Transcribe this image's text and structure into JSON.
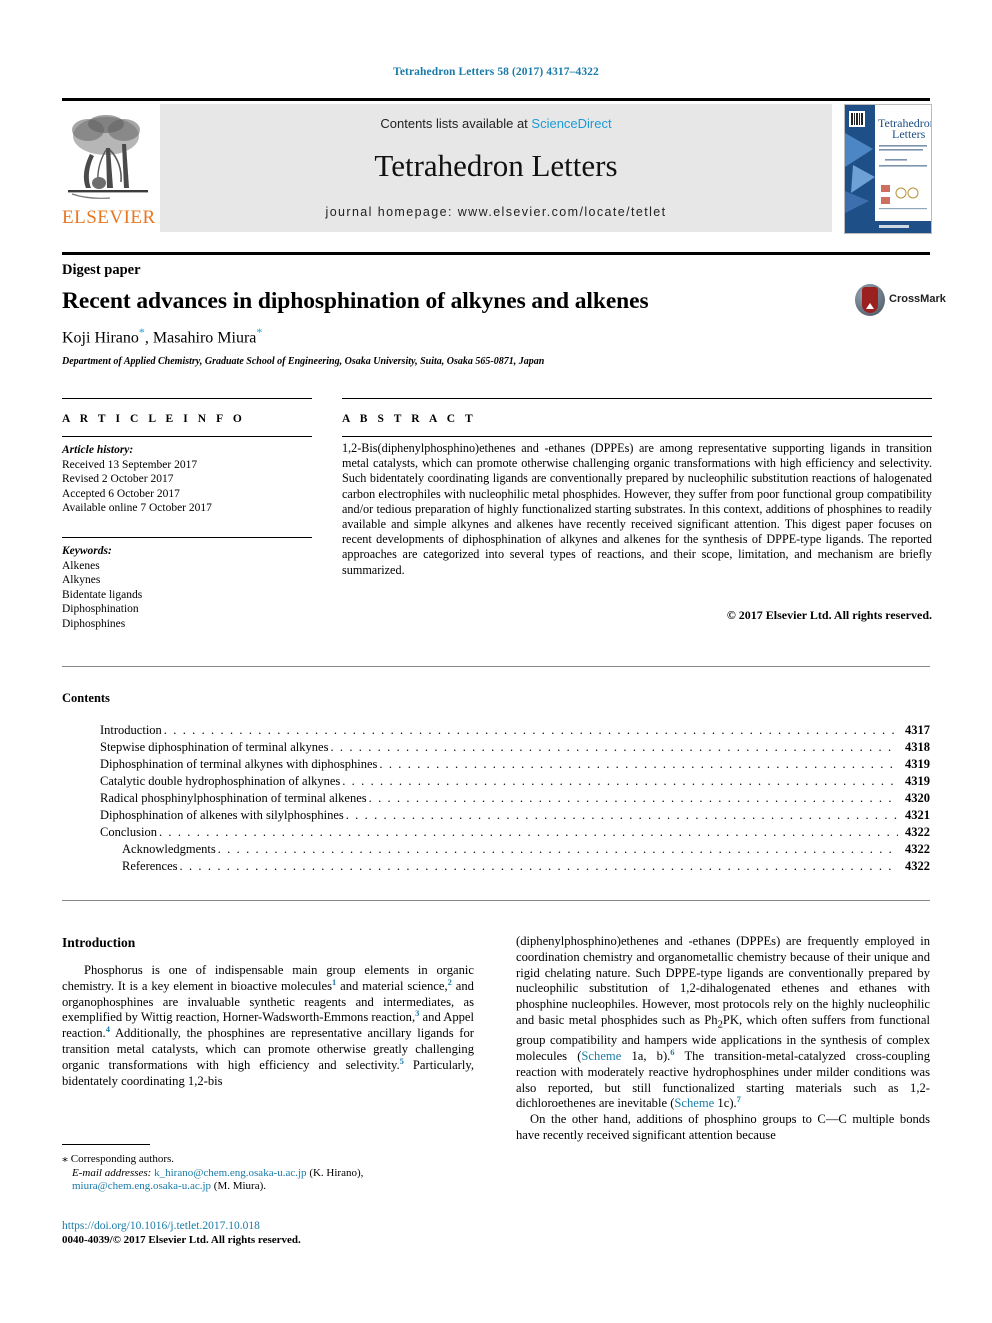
{
  "running_head": "Tetrahedron Letters 58 (2017) 4317–4322",
  "masthead": {
    "contents_prefix": "Contents lists available at ",
    "sciencedirect": "ScienceDirect",
    "journal_name": "Tetrahedron Letters",
    "homepage": "journal homepage: www.elsevier.com/locate/tetlet",
    "publisher": "ELSEVIER",
    "cover_title_line1": "Tetrahedron",
    "cover_title_line2": "Letters"
  },
  "article": {
    "type_label": "Digest paper",
    "title": "Recent advances in diphosphination of alkynes and alkenes",
    "authors": "Koji Hirano , Masahiro Miura",
    "author1": "Koji Hirano",
    "author2": "Masahiro Miura",
    "affiliation": "Department of Applied Chemistry, Graduate School of Engineering, Osaka University, Suita, Osaka 565-0871, Japan",
    "crossmark_label": "CrossMark"
  },
  "info": {
    "heading": "A R T I C L E  I N F O",
    "history_label": "Article history:",
    "history": [
      "Received 13 September 2017",
      "Revised 2 October 2017",
      "Accepted 6 October 2017",
      "Available online 7 October 2017"
    ],
    "keywords_label": "Keywords:",
    "keywords": [
      "Alkenes",
      "Alkynes",
      "Bidentate ligands",
      "Diphosphination",
      "Diphosphines"
    ]
  },
  "abstract": {
    "heading": "A B S T R A C T",
    "text": "1,2-Bis(diphenylphosphino)ethenes and -ethanes (DPPEs) are among representative supporting ligands in transition metal catalysts, which can promote otherwise challenging organic transformations with high efficiency and selectivity. Such bidentately coordinating ligands are conventionally prepared by nucleophilic substitution reactions of halogenated carbon electrophiles with nucleophilic metal phosphides. However, they suffer from poor functional group compatibility and/or tedious preparation of highly functionalized starting substrates. In this context, additions of phosphines to readily available and simple alkynes and alkenes have recently received significant attention. This digest paper focuses on recent developments of diphosphination of alkynes and alkenes for the synthesis of DPPE-type ligands. The reported approaches are categorized into several types of reactions, and their scope, limitation, and mechanism are briefly summarized.",
    "copyright": "© 2017 Elsevier Ltd. All rights reserved."
  },
  "contents": {
    "heading": "Contents",
    "entries": [
      {
        "label": "Introduction",
        "page": "4317",
        "indent": false
      },
      {
        "label": "Stepwise diphosphination of terminal alkynes",
        "page": "4318",
        "indent": false
      },
      {
        "label": "Diphosphination of terminal alkynes with diphosphines",
        "page": "4319",
        "indent": false
      },
      {
        "label": "Catalytic double hydrophosphination of alkynes",
        "page": "4319",
        "indent": false
      },
      {
        "label": "Radical phosphinylphosphination of terminal alkenes",
        "page": "4320",
        "indent": false
      },
      {
        "label": "Diphosphination of alkenes with silylphosphines",
        "page": "4321",
        "indent": false
      },
      {
        "label": "Conclusion",
        "page": "4322",
        "indent": false
      },
      {
        "label": "Acknowledgments",
        "page": "4322",
        "indent": true
      },
      {
        "label": "References",
        "page": "4322",
        "indent": true
      }
    ]
  },
  "body": {
    "intro_heading": "Introduction",
    "left_para_1_a": "Phosphorus is one of indispensable main group elements in organic chemistry. It is a key element in bioactive molecules",
    "left_ref_1": "1",
    "left_para_1_b": " and material science,",
    "left_ref_2": "2",
    "left_para_1_c": " and organophosphines are invaluable synthetic reagents and intermediates, as exemplified by Wittig reaction, Horner-Wadsworth-Emmons reaction,",
    "left_ref_3": "3",
    "left_para_1_d": " and Appel reaction.",
    "left_ref_4": "4",
    "left_para_1_e": " Additionally, the phosphines are representative ancillary ligands for transition metal catalysts, which can promote otherwise greatly challenging organic transformations with high efficiency and selectivity.",
    "left_ref_5": "5",
    "left_para_1_f": " Particularly, bidentately coordinating 1,2-bis",
    "right_para_1_a": "(diphenylphosphino)ethenes and -ethanes (DPPEs) are frequently employed in coordination chemistry and organometallic chemistry because of their unique and rigid chelating nature. Such DPPE-type ligands are conventionally prepared by nucleophilic substitution of 1,2-dihalogenated ethenes and ethanes with phosphine nucleophiles. However, most protocols rely on the highly nucleophilic and basic metal phosphides such as Ph",
    "right_sub_2": "2",
    "right_para_1_b": "PK, which often suffers from functional group compatibility and hampers wide applications in the synthesis of complex molecules (",
    "right_link_scheme1ab": "Scheme",
    "right_para_1_c": " 1a, b).",
    "right_ref_6": "6",
    "right_para_1_d": " The transition-metal-catalyzed cross-coupling reaction with moderately reactive hydrophosphines under milder conditions was also reported, but still functionalized starting materials such as 1,2-dichloroethenes are inevitable (",
    "right_link_scheme1c": "Scheme",
    "right_para_1_e": " 1c).",
    "right_ref_7": "7",
    "right_para_2": "On the other hand, additions of phosphino groups to C—C multiple bonds have recently received significant attention because"
  },
  "footnote": {
    "corresponding": "Corresponding authors.",
    "email_label": "E-mail addresses:",
    "email1": "k_hirano@chem.eng.osaka-u.ac.jp",
    "email1_name": " (K. Hirano), ",
    "email2": "miura@chem.eng.osaka-u.ac.jp",
    "email2_name": " (M. Miura)."
  },
  "doi": {
    "url": "https://doi.org/10.1016/j.tetlet.2017.10.018",
    "copyline": "0040-4039/© 2017 Elsevier Ltd. All rights reserved."
  },
  "colors": {
    "link_blue": "#1a9bd7",
    "head_teal": "#1a7ba8",
    "elsevier_orange": "#E87722",
    "band_grey": "#e7e7e7"
  }
}
